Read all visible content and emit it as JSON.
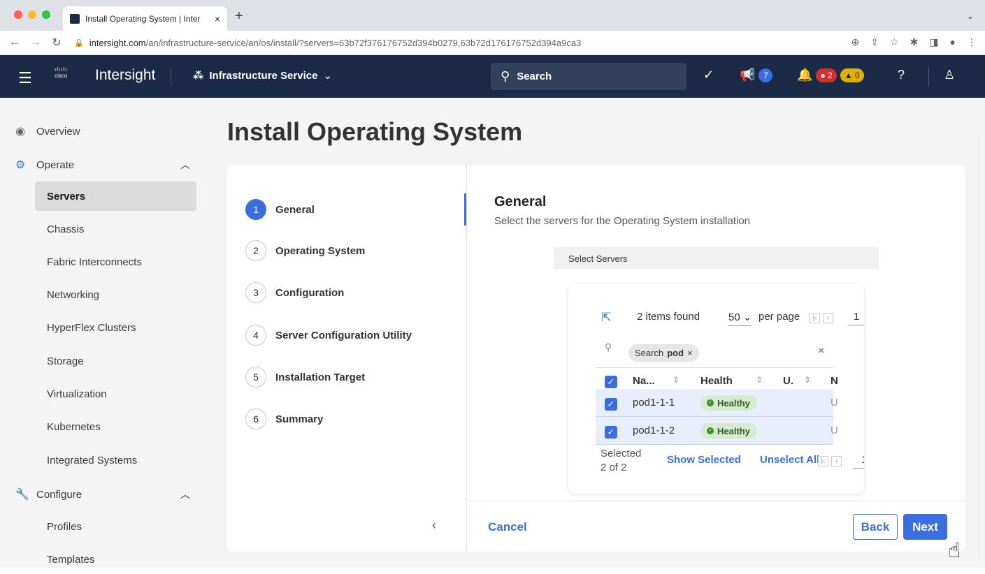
{
  "browser": {
    "tab_title": "Install Operating System | Inter",
    "url_host": "intersight.com",
    "url_path": "/an/infrastructure-service/an/os/install/?servers=63b72f376176752d394b0279,63b72d176176752d394a9ca3"
  },
  "header": {
    "brand": "Intersight",
    "logo_text": "cisco",
    "service": "Infrastructure Service",
    "search_label": "Search",
    "announcements_count": "7",
    "alarms_critical": "2",
    "alarms_warning": "0"
  },
  "sidebar": {
    "overview": "Overview",
    "operate": "Operate",
    "items": [
      {
        "label": "Servers"
      },
      {
        "label": "Chassis"
      },
      {
        "label": "Fabric Interconnects"
      },
      {
        "label": "Networking"
      },
      {
        "label": "HyperFlex Clusters"
      },
      {
        "label": "Storage"
      },
      {
        "label": "Virtualization"
      },
      {
        "label": "Kubernetes"
      },
      {
        "label": "Integrated Systems"
      }
    ],
    "configure": "Configure",
    "config_items": [
      {
        "label": "Profiles"
      },
      {
        "label": "Templates"
      }
    ]
  },
  "page": {
    "title": "Install Operating System",
    "steps": [
      {
        "num": "1",
        "label": "General"
      },
      {
        "num": "2",
        "label": "Operating System"
      },
      {
        "num": "3",
        "label": "Configuration"
      },
      {
        "num": "4",
        "label": "Server Configuration Utility"
      },
      {
        "num": "5",
        "label": "Installation Target"
      },
      {
        "num": "6",
        "label": "Summary"
      }
    ],
    "section_title": "General",
    "section_subtitle": "Select the servers for the Operating System installation",
    "select_servers_label": "Select Servers"
  },
  "table": {
    "items_found": "2 items found",
    "per_page_value": "50",
    "per_page_label": "per page",
    "page_number": "1",
    "search_chip": "Search",
    "search_chip_term": "pod",
    "columns": [
      "Na...",
      "Health",
      "U.",
      "N"
    ],
    "rows": [
      {
        "name": "pod1-1-1",
        "health": "Healthy",
        "extra": "U"
      },
      {
        "name": "pod1-1-2",
        "health": "Healthy",
        "extra": "U"
      }
    ],
    "selected_label": "Selected",
    "selected_count": "2 of 2",
    "show_selected": "Show Selected",
    "unselect_all": "Unselect All",
    "footer_page": "1"
  },
  "footer": {
    "cancel": "Cancel",
    "back": "Back",
    "next": "Next"
  },
  "colors": {
    "header_bg": "#1b2a46",
    "accent": "#3b6fe0",
    "healthy": "#3c8b2f"
  }
}
